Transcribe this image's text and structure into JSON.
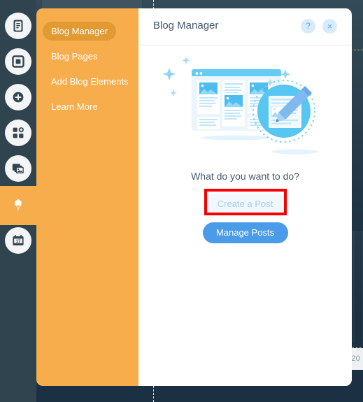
{
  "background": {
    "footer_copyright": "© 20",
    "colors": {
      "canvas": "#2d4250",
      "footer": "#eef0f1",
      "guide": "#f2f4f5"
    }
  },
  "rail": {
    "items": [
      {
        "name": "pages-icon",
        "label": "Pages",
        "active": false
      },
      {
        "name": "sections-icon",
        "label": "Sections",
        "active": false
      },
      {
        "name": "add-icon",
        "label": "Add",
        "active": false
      },
      {
        "name": "apps-icon",
        "label": "Add Apps",
        "active": false
      },
      {
        "name": "media-icon",
        "label": "Media",
        "active": false
      },
      {
        "name": "blog-pen-icon",
        "label": "Blog",
        "active": true
      },
      {
        "name": "bookings-icon",
        "label": "Bookings",
        "active": false
      }
    ]
  },
  "sidebar": {
    "items": [
      {
        "label": "Blog Manager",
        "active": true
      },
      {
        "label": "Blog Pages",
        "active": false
      },
      {
        "label": "Add Blog Elements",
        "active": false
      },
      {
        "label": "Learn More",
        "active": false
      }
    ],
    "color": "#f7ad4c",
    "active_color": "#e29a33"
  },
  "dialog": {
    "title": "Blog Manager",
    "help_button": "?",
    "close_button": "×",
    "illustration": {
      "name": "blog-posts-illustration",
      "description": "Browser window with blog post cards and a circular magnifier with pencil"
    },
    "prompt": "What do you want to do?",
    "buttons": [
      {
        "label": "Create a Post",
        "style": "ghost",
        "highlighted": true
      },
      {
        "label": "Manage Posts",
        "style": "primary",
        "highlighted": false
      }
    ],
    "accent_color": "#4a9be8",
    "highlight_color": "#f60000"
  }
}
